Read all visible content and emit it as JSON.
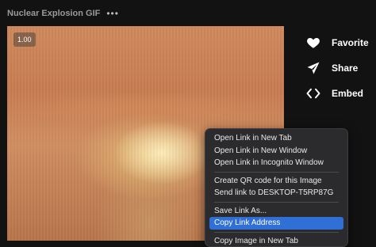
{
  "header": {
    "title": "Nuclear Explosion GIF",
    "more_glyph": "•••"
  },
  "gif": {
    "speed": "1.00"
  },
  "actions": [
    {
      "label": "Favorite",
      "icon": "heart-icon"
    },
    {
      "label": "Share",
      "icon": "send-icon"
    },
    {
      "label": "Embed",
      "icon": "code-icon"
    }
  ],
  "context_menu": {
    "items": [
      "Open Link in New Tab",
      "Open Link in New Window",
      "Open Link in Incognito Window",
      "Create QR code for this Image",
      "Send link to DESKTOP-T5RP87G",
      "Save Link As...",
      "Copy Link Address",
      "Copy Image in New Tab"
    ],
    "highlighted": "Copy Link Address",
    "highlight_color": "#2f6fd6"
  }
}
